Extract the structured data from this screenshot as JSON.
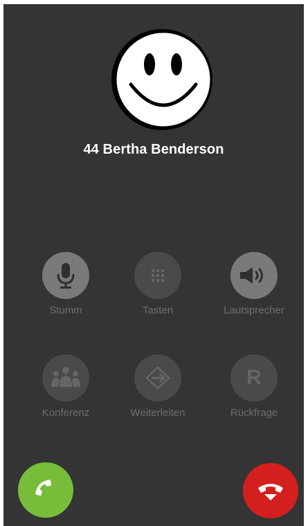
{
  "caller": {
    "name": "44 Bertha Benderson",
    "avatar_icon": "smiley-face-icon"
  },
  "controls": [
    {
      "label": "Stumm",
      "icon": "microphone-icon",
      "enabled": true
    },
    {
      "label": "Tasten",
      "icon": "keypad-icon",
      "enabled": false
    },
    {
      "label": "Lautsprecher",
      "icon": "speaker-icon",
      "enabled": true
    },
    {
      "label": "Konferenz",
      "icon": "conference-icon",
      "enabled": false
    },
    {
      "label": "Weiterleiten",
      "icon": "transfer-icon",
      "enabled": false
    },
    {
      "label": "Rückfrage",
      "icon": "consultation-icon",
      "enabled": false,
      "glyph": "R"
    }
  ],
  "actions": {
    "accept_icon": "accept-call-icon",
    "accept_color": "#78bd3a",
    "hangup_icon": "hangup-icon",
    "hangup_color": "#d41f1f"
  },
  "colors": {
    "background": "#343434",
    "button_active": "#7a7a7a",
    "button_inactive": "#4a4a4a",
    "label": "#6e6e6e"
  }
}
